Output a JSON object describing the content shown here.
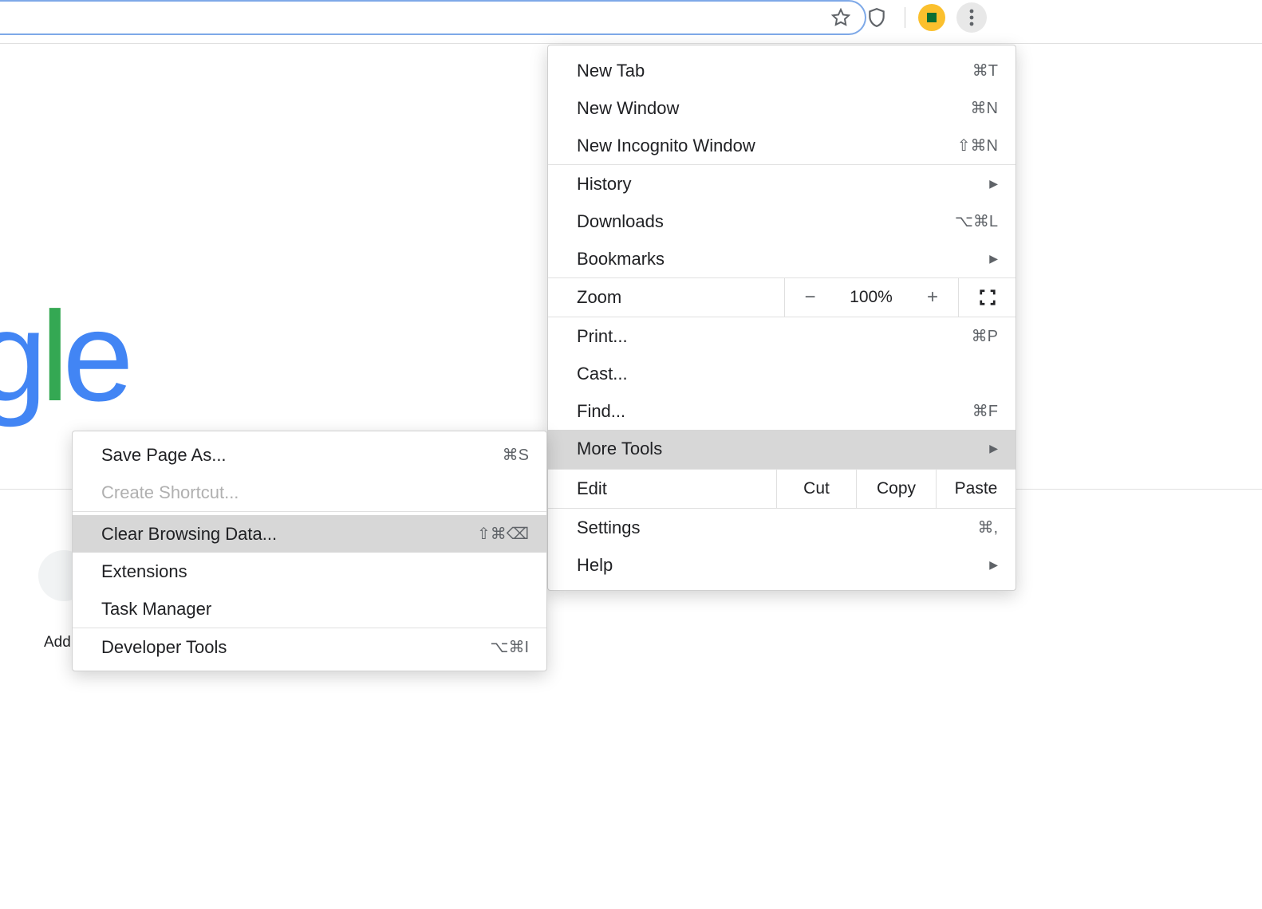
{
  "omnibox": {
    "value": ""
  },
  "page": {
    "logo_fragment": [
      "g",
      "l",
      "e"
    ],
    "shortcut_label_partial": "Add s"
  },
  "menu": {
    "new_tab": {
      "label": "New Tab",
      "shortcut": "⌘T"
    },
    "new_window": {
      "label": "New Window",
      "shortcut": "⌘N"
    },
    "new_incognito": {
      "label": "New Incognito Window",
      "shortcut": "⇧⌘N"
    },
    "history": {
      "label": "History"
    },
    "downloads": {
      "label": "Downloads",
      "shortcut": "⌥⌘L"
    },
    "bookmarks": {
      "label": "Bookmarks"
    },
    "zoom": {
      "label": "Zoom",
      "value": "100%"
    },
    "print": {
      "label": "Print...",
      "shortcut": "⌘P"
    },
    "cast": {
      "label": "Cast..."
    },
    "find": {
      "label": "Find...",
      "shortcut": "⌘F"
    },
    "more_tools": {
      "label": "More Tools"
    },
    "edit": {
      "label": "Edit",
      "cut": "Cut",
      "copy": "Copy",
      "paste": "Paste"
    },
    "settings": {
      "label": "Settings",
      "shortcut": "⌘,"
    },
    "help": {
      "label": "Help"
    }
  },
  "submenu": {
    "save_page_as": {
      "label": "Save Page As...",
      "shortcut": "⌘S"
    },
    "create_shortcut": {
      "label": "Create Shortcut..."
    },
    "clear_browsing_data": {
      "label": "Clear Browsing Data...",
      "shortcut": "⇧⌘⌫"
    },
    "extensions": {
      "label": "Extensions"
    },
    "task_manager": {
      "label": "Task Manager"
    },
    "developer_tools": {
      "label": "Developer Tools",
      "shortcut": "⌥⌘I"
    }
  }
}
